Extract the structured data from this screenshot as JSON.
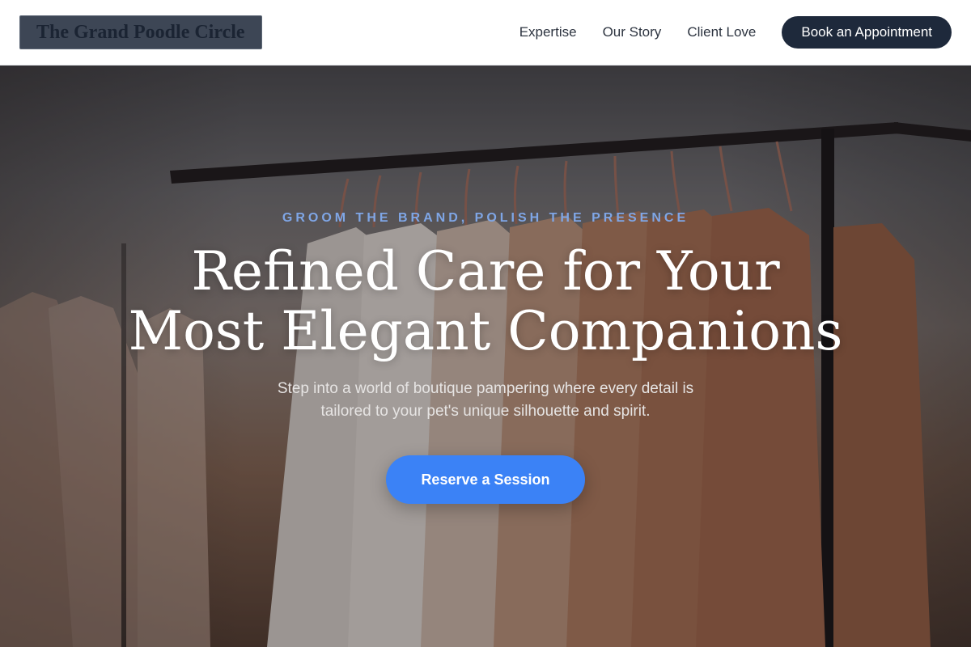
{
  "header": {
    "logo_text": "The Grand Poodle Circle",
    "nav": [
      {
        "label": "Expertise"
      },
      {
        "label": "Our Story"
      },
      {
        "label": "Client Love"
      }
    ],
    "cta_label": "Book an Appointment"
  },
  "hero": {
    "eyebrow": "GROOM THE BRAND, POLISH THE PRESENCE",
    "headline_lines": [
      "Refined Care for Your",
      "Most Elegant Companions"
    ],
    "subtext_lines": [
      "Step into a world of boutique pampering where every detail is",
      "tailored to your pet's unique silhouette and spirit."
    ],
    "cta_label": "Reserve a Session",
    "background_image": "clothing-rack-photo"
  },
  "colors": {
    "header_bg": "#ffffff",
    "logo_bg": "#3d4655",
    "logo_text": "#1b2433",
    "nav_text": "#2d3440",
    "nav_cta_bg": "#1e293b",
    "eyebrow": "#7fa6e6",
    "hero_cta_bg": "#3b82f6",
    "hero_text": "#ffffff"
  }
}
